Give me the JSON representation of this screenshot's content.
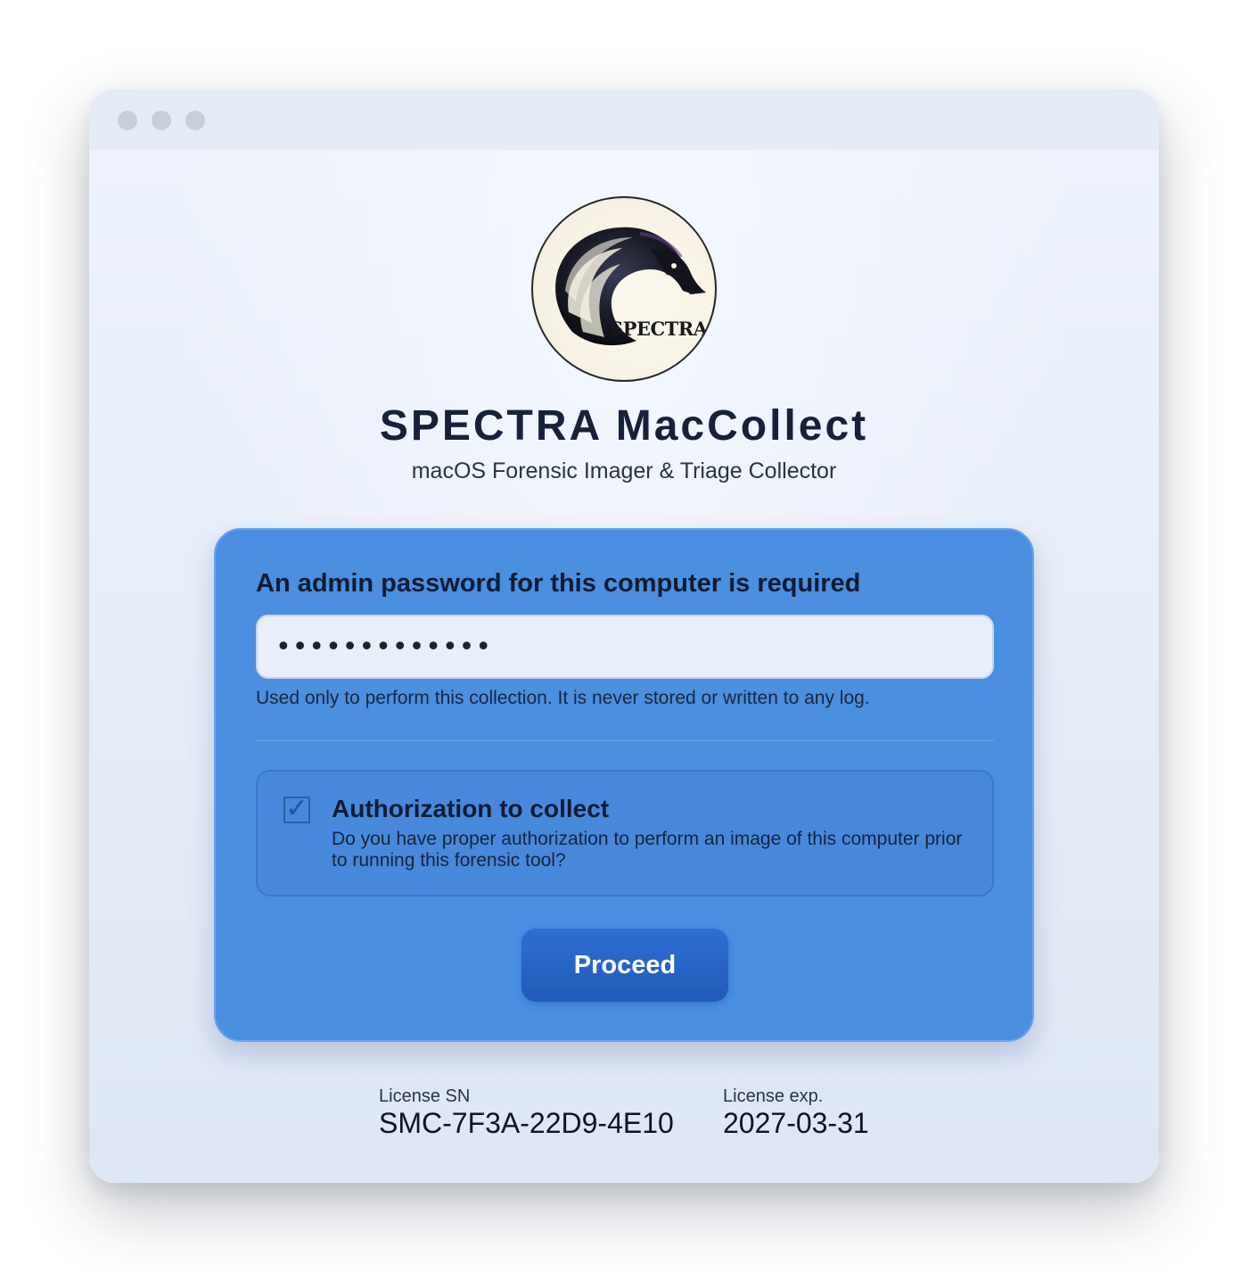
{
  "window": {
    "controls": [
      "close",
      "minimize",
      "zoom"
    ]
  },
  "app": {
    "title": "SPECTRA MacCollect",
    "subtitle": "macOS Forensic Imager & Triage Collector",
    "logo_text": "SPECTRA"
  },
  "auth_card": {
    "heading": "An admin password for this computer is required",
    "password_value": "•••••••••••••",
    "password_note": "Used only to perform this collection. It is never stored or written to any log.",
    "authorization": {
      "checked": true,
      "checkbox_glyph": "✓",
      "title": "Authorization to collect",
      "description": "Do you have proper authorization to perform an image of this computer prior to running this forensic tool?"
    },
    "proceed_label": "Proceed"
  },
  "license": {
    "sn_label": "License SN",
    "sn_value": "SMC-7F3A-22D9-4E10",
    "exp_label": "License exp.",
    "exp_value": "2027-03-31"
  },
  "colors": {
    "card": "#4a8fe0",
    "button": "#2563c6",
    "title": "#17223a"
  }
}
